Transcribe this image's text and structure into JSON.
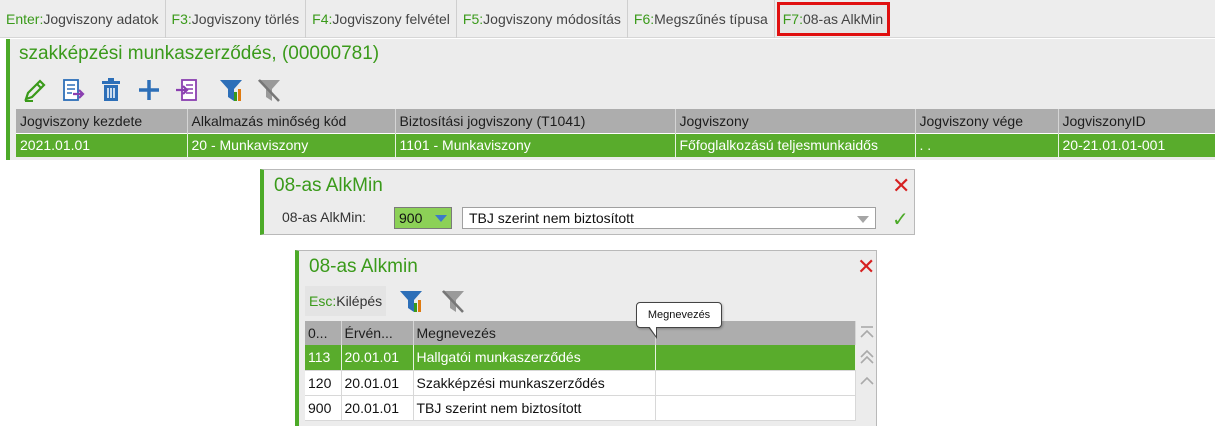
{
  "fkeys": [
    {
      "key": "Enter:",
      "label": "Jogviszony adatok"
    },
    {
      "key": "F3:",
      "label": "Jogviszony törlés"
    },
    {
      "key": "F4:",
      "label": "Jogviszony felvétel"
    },
    {
      "key": "F5:",
      "label": "Jogviszony módosítás"
    },
    {
      "key": "F6:",
      "label": "Megszűnés típusa"
    },
    {
      "key": "F7:",
      "label": "08-as AlkMin"
    }
  ],
  "main": {
    "title": "szakképzési munkaszerződés, (00000781)",
    "toolbar_icons": [
      "pencil-icon",
      "export-icon",
      "trash-icon",
      "plus-icon",
      "import-icon",
      "filter-icon",
      "filter-clear-icon"
    ],
    "columns": [
      "Jogviszony kezdete",
      "Alkalmazás minőség kód",
      "Biztosítási jogviszony (T1041)",
      "Jogviszony",
      "Jogviszony vége",
      "JogviszonyID"
    ],
    "rows": [
      [
        "2021.01.01",
        "20 - Munkaviszony",
        "1101 - Munkaviszony",
        "Főfoglalkozású teljesmunkaidős",
        ".  .",
        "20-21.01.01-001"
      ]
    ]
  },
  "dialog1": {
    "title": "08-as AlkMin",
    "field_label": "08-as AlkMin:",
    "code_value": "900",
    "desc_value": "TBJ szerint nem biztosított",
    "close_icon": "close-icon",
    "ok_icon": "check-icon"
  },
  "dialog2": {
    "title": "08-as Alkmin",
    "esc_key": "Esc:",
    "esc_label": "Kilépés",
    "columns": [
      "0...",
      "Érvén...",
      "Megnevezés",
      ""
    ],
    "rows": [
      [
        "113",
        "20.01.01",
        "Hallgatói munkaszerződés",
        ""
      ],
      [
        "120",
        "20.01.01",
        "Szakképzési munkaszerződés",
        ""
      ],
      [
        "900",
        "20.01.01",
        "TBJ szerint nem biztosított",
        ""
      ]
    ],
    "selected_row": 0,
    "tooltip": "Megnevezés"
  },
  "colors": {
    "accent": "#4caa28",
    "selection": "#59ac2c",
    "highlight_border": "#e01010",
    "close": "#d62020"
  }
}
